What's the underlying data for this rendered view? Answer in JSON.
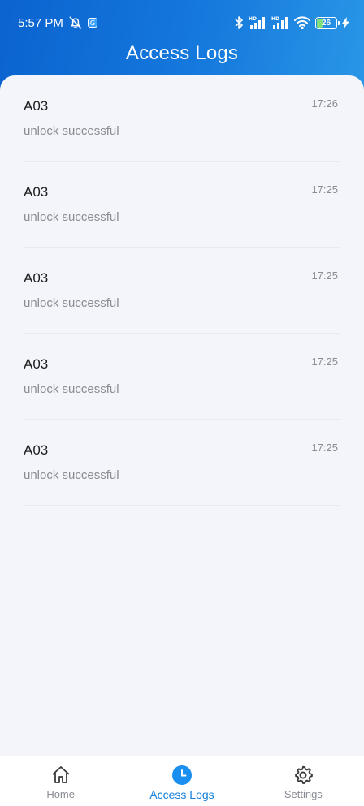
{
  "status_bar": {
    "time": "5:57 PM",
    "battery": "26",
    "network_label_1": "HD",
    "network_label_2": "HD"
  },
  "header": {
    "title": "Access Logs"
  },
  "logs": [
    {
      "door": "A03",
      "status": "unlock successful",
      "time": "17:26"
    },
    {
      "door": "A03",
      "status": "unlock successful",
      "time": "17:25"
    },
    {
      "door": "A03",
      "status": "unlock successful",
      "time": "17:25"
    },
    {
      "door": "A03",
      "status": "unlock successful",
      "time": "17:25"
    },
    {
      "door": "A03",
      "status": "unlock successful",
      "time": "17:25"
    }
  ],
  "tabbar": {
    "tabs": [
      {
        "label": "Home",
        "icon": "home-icon",
        "active": false
      },
      {
        "label": "Access Logs",
        "icon": "clock-icon",
        "active": true
      },
      {
        "label": "Settings",
        "icon": "gear-icon",
        "active": false
      }
    ]
  },
  "colors": {
    "header_start": "#0b63cf",
    "header_end": "#2a97e6",
    "accent": "#1380dd",
    "background": "#f4f5fa"
  }
}
